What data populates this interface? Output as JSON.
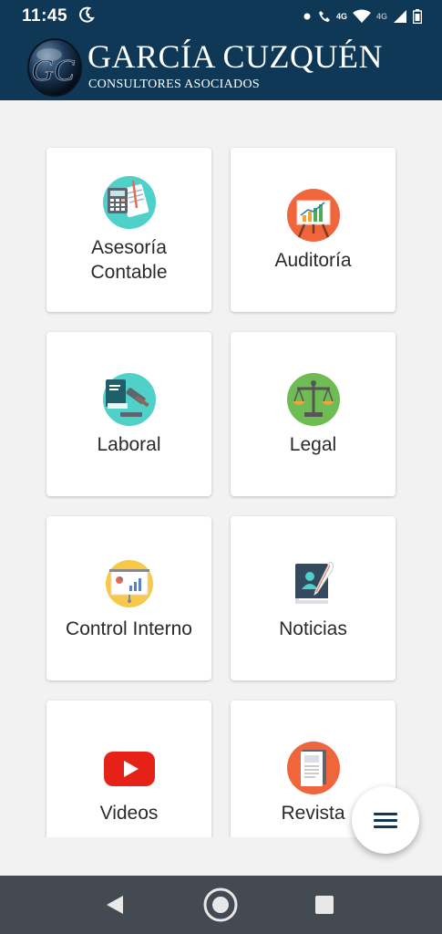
{
  "status_bar": {
    "time": "11:45",
    "net_label_1": "4G",
    "net_label_2": "4G"
  },
  "header": {
    "logo_letters": "GC",
    "title": "GARCÍA CUZQUÉN",
    "subtitle": "CONSULTORES ASOCIADOS"
  },
  "menu": {
    "items": [
      {
        "label": "Asesoría\nContable",
        "icon": "accounting-calculator-icon"
      },
      {
        "label": "Auditoría",
        "icon": "audit-chart-board-icon"
      },
      {
        "label": "Laboral",
        "icon": "labor-gavel-book-icon"
      },
      {
        "label": "Legal",
        "icon": "legal-scales-icon"
      },
      {
        "label": "Control Interno",
        "icon": "internal-control-presentation-icon"
      },
      {
        "label": "Noticias",
        "icon": "news-notebook-icon"
      },
      {
        "label": "Videos",
        "icon": "youtube-play-icon"
      },
      {
        "label": "Revista",
        "icon": "magazine-icon"
      }
    ]
  },
  "fab": {
    "icon": "menu-icon"
  },
  "colors": {
    "header_bg": "#0f3856",
    "page_bg": "#f2f2f2",
    "nav_bg": "#444a52",
    "fab_icon": "#0f3856",
    "youtube_red": "#e62117"
  }
}
